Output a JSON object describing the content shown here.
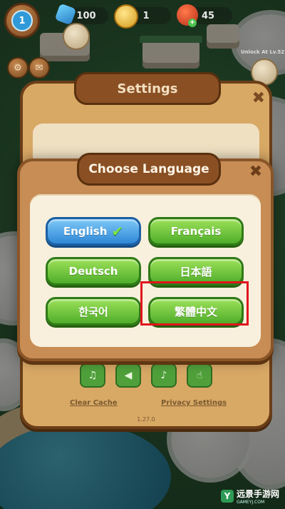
{
  "top_bar": {
    "level": "1",
    "gems": "100",
    "coins": "1",
    "energy": "45",
    "unlock_text": "Unlock At Lv.52"
  },
  "settings_panel": {
    "title": "Settings",
    "links": [
      "Clear Cache",
      "Privacy Settings"
    ],
    "version": "1.27.0"
  },
  "language_modal": {
    "title": "Choose Language",
    "languages": [
      {
        "label": "English",
        "selected": true
      },
      {
        "label": "Français",
        "selected": false
      },
      {
        "label": "Deutsch",
        "selected": false
      },
      {
        "label": "日本語",
        "selected": false
      },
      {
        "label": "한국어",
        "selected": false
      },
      {
        "label": "繁體中文",
        "selected": false
      }
    ]
  },
  "watermark": {
    "name": "远景手游网",
    "domain": "GAMEYJ.COM"
  },
  "colors": {
    "selected_button": "#2f87d6",
    "language_button": "#4fae2a",
    "highlight_box": "#e0141c",
    "modal_frame": "#c88d55"
  }
}
